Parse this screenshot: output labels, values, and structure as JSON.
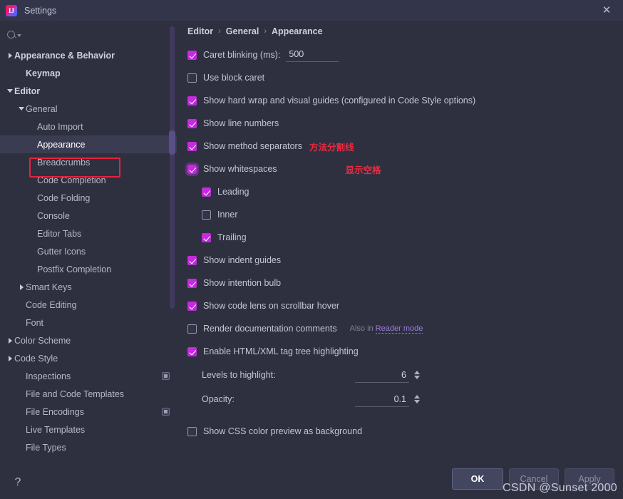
{
  "window": {
    "title": "Settings",
    "app_icon": "intellij-idea-icon",
    "close_icon": "close-icon"
  },
  "sidebar": {
    "search_placeholder": "",
    "search_icon": "search-icon",
    "help_icon": "help-icon",
    "items": [
      {
        "label": "Appearance & Behavior",
        "indent": 0,
        "arrow": "collapsed",
        "bold": true,
        "selected": false,
        "badge": false
      },
      {
        "label": "Keymap",
        "indent": 1,
        "arrow": "none",
        "bold": true,
        "selected": false,
        "badge": false
      },
      {
        "label": "Editor",
        "indent": 0,
        "arrow": "expanded",
        "bold": true,
        "selected": false,
        "badge": false
      },
      {
        "label": "General",
        "indent": 1,
        "arrow": "expanded",
        "bold": false,
        "selected": false,
        "badge": false
      },
      {
        "label": "Auto Import",
        "indent": 2,
        "arrow": "none",
        "bold": false,
        "selected": false,
        "badge": false
      },
      {
        "label": "Appearance",
        "indent": 2,
        "arrow": "none",
        "bold": false,
        "selected": true,
        "badge": false
      },
      {
        "label": "Breadcrumbs",
        "indent": 2,
        "arrow": "none",
        "bold": false,
        "selected": false,
        "badge": false
      },
      {
        "label": "Code Completion",
        "indent": 2,
        "arrow": "none",
        "bold": false,
        "selected": false,
        "badge": false
      },
      {
        "label": "Code Folding",
        "indent": 2,
        "arrow": "none",
        "bold": false,
        "selected": false,
        "badge": false
      },
      {
        "label": "Console",
        "indent": 2,
        "arrow": "none",
        "bold": false,
        "selected": false,
        "badge": false
      },
      {
        "label": "Editor Tabs",
        "indent": 2,
        "arrow": "none",
        "bold": false,
        "selected": false,
        "badge": false
      },
      {
        "label": "Gutter Icons",
        "indent": 2,
        "arrow": "none",
        "bold": false,
        "selected": false,
        "badge": false
      },
      {
        "label": "Postfix Completion",
        "indent": 2,
        "arrow": "none",
        "bold": false,
        "selected": false,
        "badge": false
      },
      {
        "label": "Smart Keys",
        "indent": 1,
        "arrow": "collapsed",
        "bold": false,
        "selected": false,
        "badge": false
      },
      {
        "label": "Code Editing",
        "indent": 1,
        "arrow": "none",
        "bold": false,
        "selected": false,
        "badge": false
      },
      {
        "label": "Font",
        "indent": 1,
        "arrow": "none",
        "bold": false,
        "selected": false,
        "badge": false
      },
      {
        "label": "Color Scheme",
        "indent": 0,
        "arrow": "collapsed",
        "bold": false,
        "selected": false,
        "badge": false
      },
      {
        "label": "Code Style",
        "indent": 0,
        "arrow": "collapsed",
        "bold": false,
        "selected": false,
        "badge": false
      },
      {
        "label": "Inspections",
        "indent": 1,
        "arrow": "none",
        "bold": false,
        "selected": false,
        "badge": true
      },
      {
        "label": "File and Code Templates",
        "indent": 1,
        "arrow": "none",
        "bold": false,
        "selected": false,
        "badge": false
      },
      {
        "label": "File Encodings",
        "indent": 1,
        "arrow": "none",
        "bold": false,
        "selected": false,
        "badge": true
      },
      {
        "label": "Live Templates",
        "indent": 1,
        "arrow": "none",
        "bold": false,
        "selected": false,
        "badge": false
      },
      {
        "label": "File Types",
        "indent": 1,
        "arrow": "none",
        "bold": false,
        "selected": false,
        "badge": false
      }
    ],
    "annotation_box_color": "#e8223c"
  },
  "breadcrumb": {
    "items": [
      "Editor",
      "General",
      "Appearance"
    ],
    "separator": "›"
  },
  "main": {
    "caret_blinking": {
      "label": "Caret blinking (ms):",
      "checked": true,
      "value": "500"
    },
    "options": [
      {
        "label": "Use block caret",
        "checked": false,
        "indent": 0,
        "focused": false
      },
      {
        "label": "Show hard wrap and visual guides (configured in Code Style options)",
        "checked": true,
        "indent": 0,
        "focused": false
      },
      {
        "label": "Show line numbers",
        "checked": true,
        "indent": 0,
        "focused": false
      },
      {
        "label": "Show method separators",
        "checked": true,
        "indent": 0,
        "focused": false,
        "annotation": "方法分割线",
        "annotation_class": "a1"
      },
      {
        "label": "Show whitespaces",
        "checked": true,
        "indent": 0,
        "focused": true,
        "annotation": "显示空格",
        "annotation_class": "a2"
      },
      {
        "label": "Leading",
        "checked": true,
        "indent": 1,
        "focused": false
      },
      {
        "label": "Inner",
        "checked": false,
        "indent": 1,
        "focused": false
      },
      {
        "label": "Trailing",
        "checked": true,
        "indent": 1,
        "focused": false
      },
      {
        "label": "Show indent guides",
        "checked": true,
        "indent": 0,
        "focused": false
      },
      {
        "label": "Show intention bulb",
        "checked": true,
        "indent": 0,
        "focused": false
      },
      {
        "label": "Show code lens on scrollbar hover",
        "checked": true,
        "indent": 0,
        "focused": false
      },
      {
        "label": "Render documentation comments",
        "checked": false,
        "indent": 0,
        "focused": false,
        "hint_prefix": "Also in ",
        "hint_link": "Reader mode"
      },
      {
        "label": "Enable HTML/XML tag tree highlighting",
        "checked": true,
        "indent": 0,
        "focused": false
      }
    ],
    "spinners": [
      {
        "label": "Levels to highlight:",
        "value": "6"
      },
      {
        "label": "Opacity:",
        "value": "0.1"
      }
    ],
    "css_preview": {
      "label": "Show CSS color preview as background",
      "checked": false
    }
  },
  "footer": {
    "ok": "OK",
    "cancel": "Cancel",
    "apply": "Apply"
  },
  "watermark": "CSDN @Sunset 2000",
  "colors": {
    "accent_checkbox": "#c52ad9",
    "annotation_red": "#ee2a3e",
    "selection": "#3a3d52",
    "link": "#9a7dd8"
  }
}
